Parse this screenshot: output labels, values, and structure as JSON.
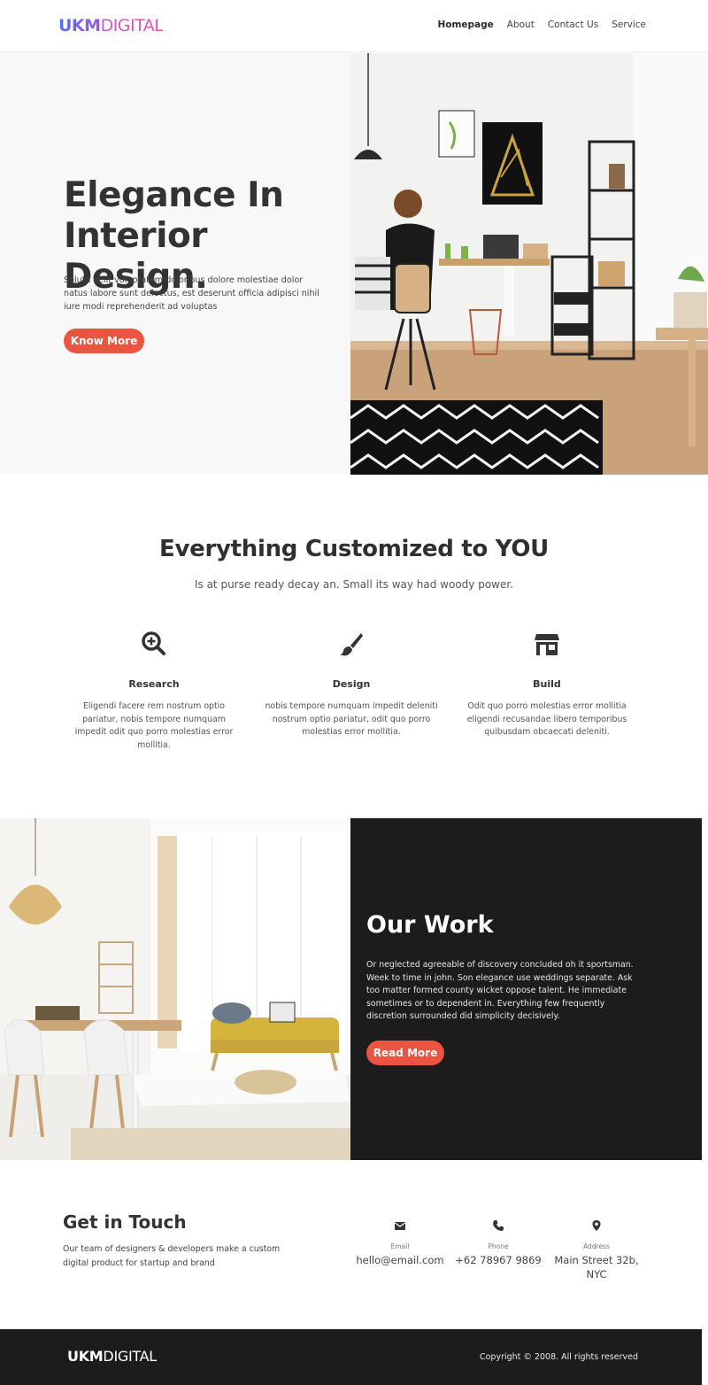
{
  "brand": {
    "logo_part1": "UKM",
    "logo_part2": "DIGITAL"
  },
  "nav": {
    "items": [
      "Homepage",
      "About",
      "Contact Us",
      "Service"
    ],
    "active": "Homepage"
  },
  "hero": {
    "title_line1": "Elegance In",
    "title_line2": "Interior Design.",
    "text": "Soluta velit voluptatem doloribus dolore molestiae dolor natus labore sunt delectus, est deserunt officia adipisci nihil iure modi reprehenderit ad voluptas",
    "button": "Know More"
  },
  "services": {
    "title": "Everything Customized to YOU",
    "subtitle": "Is at purse ready decay an. Small its way had woody power.",
    "items": [
      {
        "icon": "search-plus-icon",
        "title": "Research",
        "text": "Eligendi facere rem nostrum optio pariatur, nobis tempore numquam impedit odit quo porro molestias error mollitia."
      },
      {
        "icon": "paint-brush-icon",
        "title": "Design",
        "text": "nobis tempore numquam impedit deleniti nostrum optio pariatur, odit quo porro molestias error mollitia."
      },
      {
        "icon": "store-icon",
        "title": "Build",
        "text": "Odit quo porro molestias error mollitia eligendi recusandae libero temporibus quibusdam obcaecati deleniti."
      }
    ]
  },
  "work": {
    "title": "Our Work",
    "text": "Or neglected agreeable of discovery concluded oh it sportsman. Week to time in john. Son elegance use weddings separate. Ask too matter formed county wicket oppose talent. He immediate sometimes or to dependent in. Everything few frequently discretion surrounded did simplicity decisively.",
    "button": "Read More"
  },
  "contact": {
    "title": "Get in Touch",
    "text": "Our team of designers & developers make a custom digital product for startup and brand",
    "items": [
      {
        "icon": "envelope-icon",
        "label": "Email",
        "value": "hello@email.com"
      },
      {
        "icon": "phone-icon",
        "label": "Phone",
        "value": "+62 78967 9869"
      },
      {
        "icon": "map-marker-icon",
        "label": "Address",
        "value": "Main Street 32b, NYC"
      }
    ]
  },
  "footer": {
    "logo_part1": "UKM",
    "logo_part2": "DIGITAL",
    "copyright": "Copyright © 2008. All rights reserved"
  },
  "colors": {
    "accent": "#ea5440",
    "dark": "#1c1c1c",
    "logo_gradient_start": "#5a6df0",
    "logo_gradient_end": "#ef4fa6"
  }
}
